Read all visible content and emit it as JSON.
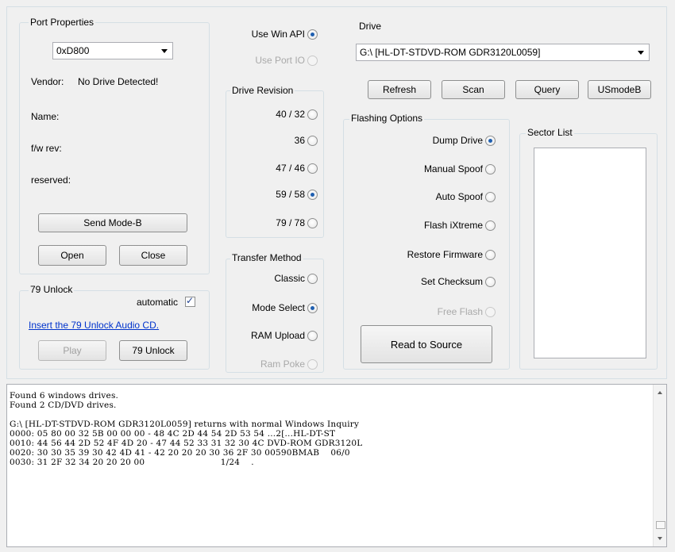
{
  "port_properties": {
    "title": "Port Properties",
    "port_value": "0xD800",
    "vendor_label": "Vendor:",
    "vendor_value": "No Drive Detected!",
    "name_label": "Name:",
    "fw_label": "f/w rev:",
    "reserved_label": "reserved:",
    "send_mode_b": "Send Mode-B",
    "open": "Open",
    "close": "Close"
  },
  "unlock79": {
    "title": "79 Unlock",
    "automatic_label": "automatic",
    "automatic_checked": true,
    "link_text": "Insert the 79 Unlock Audio CD.",
    "play": "Play",
    "unlock": "79 Unlock"
  },
  "api": {
    "use_win_api": "Use Win API",
    "use_port_io": "Use Port IO"
  },
  "drive_revision": {
    "title": "Drive Revision",
    "options": [
      "40 / 32",
      "36",
      "47 / 46",
      "59 / 58",
      "79 / 78"
    ],
    "selected": "59 / 58"
  },
  "transfer_method": {
    "title": "Transfer Method",
    "options": [
      "Classic",
      "Mode Select",
      "RAM Upload",
      "Ram Poke"
    ],
    "selected": "Mode Select"
  },
  "drive": {
    "title": "Drive",
    "selected": "G:\\ [HL-DT-STDVD-ROM GDR3120L0059]",
    "refresh": "Refresh",
    "scan": "Scan",
    "query": "Query",
    "usmodeb": "USmodeB"
  },
  "flashing_options": {
    "title": "Flashing Options",
    "options": [
      "Dump Drive",
      "Manual Spoof",
      "Auto Spoof",
      "Flash iXtreme",
      "Restore Firmware",
      "Set Checksum",
      "Free Flash"
    ],
    "selected": "Dump Drive",
    "read_to_source": "Read to Source"
  },
  "sector_list": {
    "title": "Sector List"
  },
  "log": {
    "lines": [
      "Found 6 windows drives.",
      "Found 2 CD/DVD drives.",
      "",
      "G:\\ [HL-DT-STDVD-ROM GDR3120L0059] returns with normal Windows Inquiry",
      "0000: 05 80 00 32 5B 00 00 00 - 48 4C 2D 44 54 2D 53 54 ...2[...HL-DT-ST",
      "0010: 44 56 44 2D 52 4F 4D 20 - 47 44 52 33 31 32 30 4C DVD-ROM GDR3120L",
      "0020: 30 30 35 39 30 42 4D 41 - 42 20 20 20 30 36 2F 30 00590BMAB    06/0",
      "0030: 31 2F 32 34 20 20 20 00                           1/24    ."
    ]
  },
  "colors": {
    "accent": "#1f5fb0",
    "link": "#0033cc",
    "panel_bg": "#f0f0f0",
    "border": "#d5dfe5"
  }
}
